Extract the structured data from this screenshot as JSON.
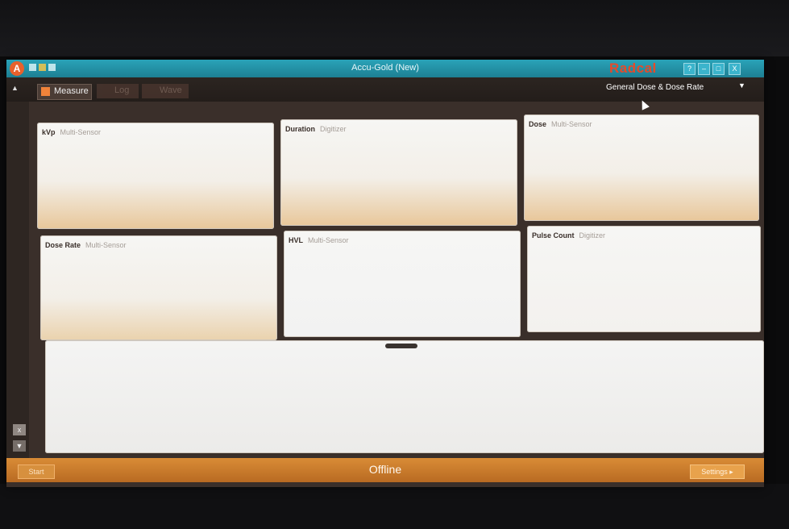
{
  "window": {
    "title": "Accu-Gold (New)",
    "brand": "Radcal",
    "help_label": "?",
    "min_label": "–",
    "max_label": "□",
    "close_label": "X"
  },
  "app_logo_label": "A",
  "ribbon": {
    "tabs": [
      {
        "label": "Measure"
      },
      {
        "label": "Log"
      },
      {
        "label": "Wave"
      }
    ],
    "preset": "General Dose & Dose Rate"
  },
  "panels": [
    {
      "name": "kVp",
      "source": "Multi-Sensor"
    },
    {
      "name": "Duration",
      "source": "Digitizer"
    },
    {
      "name": "Dose",
      "source": "Multi-Sensor"
    },
    {
      "name": "Dose Rate",
      "source": "Multi-Sensor"
    },
    {
      "name": "HVL",
      "source": "Multi-Sensor"
    },
    {
      "name": "Pulse Count",
      "source": "Digitizer"
    }
  ],
  "sidebar": {
    "close_label": "x",
    "down_label": "▼"
  },
  "statusbar": {
    "start_label": "Start",
    "status": "Offline",
    "settings_label": "Settings ▸"
  }
}
